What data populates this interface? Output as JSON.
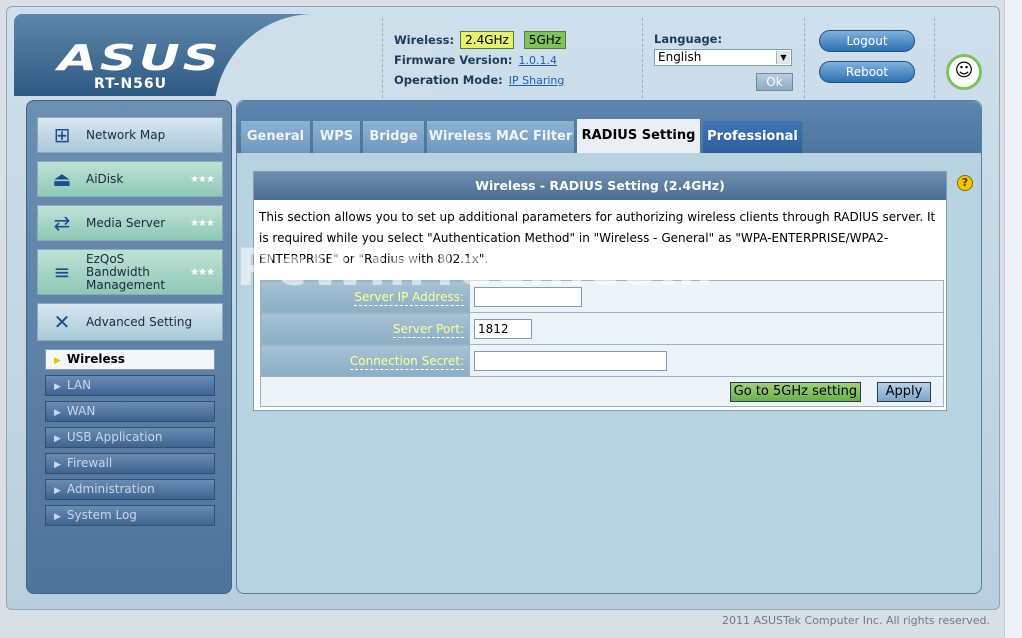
{
  "header": {
    "brand": "ASUS",
    "model": "RT-N56U",
    "wireless_label": "Wireless:",
    "band_24": "2.4GHz",
    "band_5": "5GHz",
    "firmware_label": "Firmware Version:",
    "firmware_value": "1.0.1.4",
    "opmode_label": "Operation Mode:",
    "opmode_value": "IP Sharing",
    "language_label": "Language:",
    "language_selected": "English",
    "ok_label": "Ok",
    "logout_label": "Logout",
    "reboot_label": "Reboot"
  },
  "sidebar": {
    "items": [
      {
        "label": "Network Map",
        "icon": "network-map-icon"
      },
      {
        "label": "AiDisk",
        "icon": "disk-icon"
      },
      {
        "label": "Media Server",
        "icon": "media-server-icon"
      },
      {
        "label": "EzQoS Bandwidth Management",
        "icon": "qos-icon"
      },
      {
        "label": "Advanced Setting",
        "icon": "tools-icon"
      }
    ],
    "subitems": [
      "Wireless",
      "LAN",
      "WAN",
      "USB Application",
      "Firewall",
      "Administration",
      "System Log"
    ]
  },
  "tabs": [
    "General",
    "WPS",
    "Bridge",
    "Wireless MAC Filter",
    "RADIUS Setting",
    "Professional"
  ],
  "panel": {
    "title": "Wireless - RADIUS Setting (2.4GHz)",
    "description": "This section allows you to set up additional parameters for authorizing wireless clients through RADIUS server. It is required while you select \"Authentication Method\" in \"Wireless - General\" as \"WPA-ENTERPRISE/WPA2-ENTERPRISE\" or \"Radius with 802.1x\".",
    "fields": [
      {
        "label": "Server IP Address:",
        "value": ""
      },
      {
        "label": "Server Port:",
        "value": "1812"
      },
      {
        "label": "Connection Secret:",
        "value": ""
      }
    ],
    "go5g_label": "Go to 5GHz setting",
    "apply_label": "Apply"
  },
  "watermark": "PcWinTech.com",
  "footer": "2011 ASUSTek Computer Inc. All rights reserved."
}
